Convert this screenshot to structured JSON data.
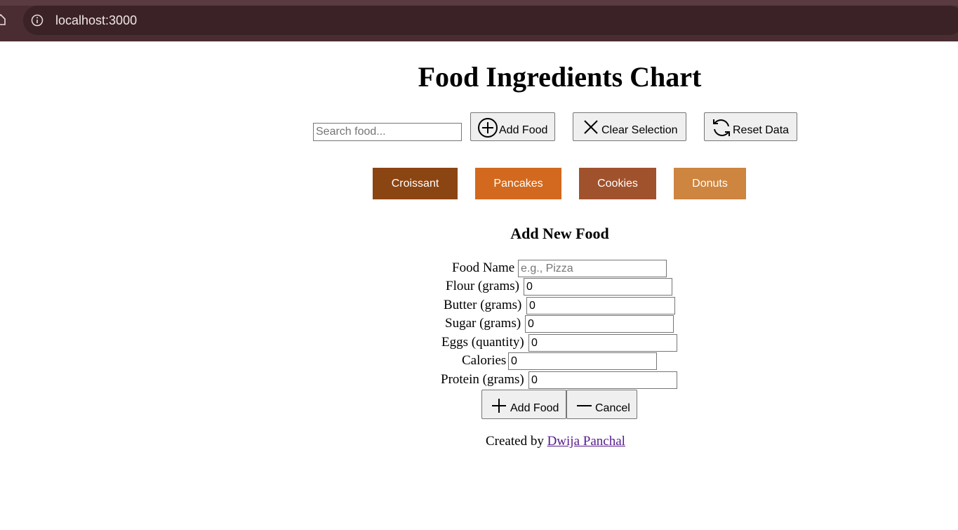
{
  "browser": {
    "url": "localhost:3000"
  },
  "page": {
    "title": "Food Ingredients Chart"
  },
  "toolbar": {
    "search_placeholder": "Search food...",
    "add_food_label": "Add Food",
    "clear_selection_label": "Clear Selection",
    "reset_data_label": "Reset Data"
  },
  "foods": [
    {
      "name": "Croissant",
      "color": "#8b4513"
    },
    {
      "name": "Pancakes",
      "color": "#d2691e"
    },
    {
      "name": "Cookies",
      "color": "#a0522d"
    },
    {
      "name": "Donuts",
      "color": "#cd853f"
    }
  ],
  "form": {
    "title": "Add New Food",
    "fields": [
      {
        "label": "Food Name",
        "value": "",
        "placeholder": "e.g., Pizza"
      },
      {
        "label": "Flour (grams)",
        "value": "0"
      },
      {
        "label": "Butter (grams)",
        "value": "0"
      },
      {
        "label": "Sugar (grams)",
        "value": "0"
      },
      {
        "label": "Eggs (quantity)",
        "value": "0"
      },
      {
        "label": "Calories",
        "value": "0"
      },
      {
        "label": "Protein (grams)",
        "value": "0"
      }
    ],
    "submit_label": "Add Food",
    "cancel_label": "Cancel"
  },
  "footer": {
    "prefix": "Created by",
    "author": "Dwija Panchal"
  },
  "icons": {
    "home": "home-icon",
    "info": "info-icon",
    "add_food": "plus-circle-icon",
    "clear": "close-icon",
    "reset": "refresh-icon",
    "submit": "plus-icon",
    "cancel": "minus-icon"
  }
}
